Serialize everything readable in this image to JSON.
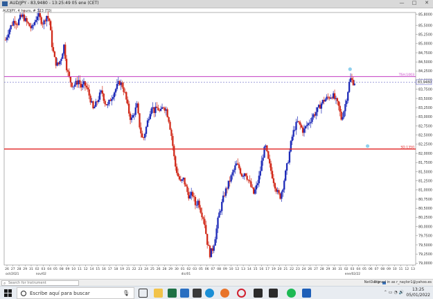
{
  "window": {
    "title": "AUD/JPY - 83,9480 - 13:25:49 05 ene (CET)",
    "controls": [
      "—",
      "□",
      "✕"
    ]
  },
  "chart_subtitle": "AUDJPY, 4 hours, # 323 (T0)",
  "colors": {
    "bull": "#1e2bb8",
    "bear": "#d12a1a",
    "upper_line": "#c13ac1",
    "lower_line": "#e02020",
    "current_line": "#6b6bc8",
    "marker": "#8fd0ee"
  },
  "annotations": {
    "upper_label": "TSH.1003",
    "lower_label": "SD.1350",
    "current_label": "83,9480"
  },
  "chart_data": {
    "type": "candlestick",
    "timeframe": "4 hours",
    "ylim": [
      78.95,
      85.85
    ],
    "y_ticks": [
      "85,8000",
      "85,5000",
      "85,2500",
      "85,0000",
      "84,7500",
      "84,5000",
      "84,2500",
      "84,0000",
      "83,7500",
      "83,5000",
      "83,2500",
      "83,0000",
      "82,7500",
      "82,5000",
      "82,2500",
      "82,0000",
      "81,7500",
      "81,5000",
      "81,2500",
      "81,0000",
      "80,7500",
      "80,5000",
      "80,2500",
      "80,0000",
      "79,7500",
      "79,5000",
      "79,2500",
      "79,0000"
    ],
    "x_ticks": [
      "26",
      "27",
      "28",
      "29",
      "31",
      "02",
      "03",
      "04",
      "05",
      "08",
      "09",
      "10",
      "11",
      "12",
      "14",
      "15",
      "16",
      "17",
      "18",
      "19",
      "21",
      "22",
      "23",
      "24",
      "25",
      "26",
      "28",
      "29",
      "30",
      "01",
      "02",
      "03",
      "05",
      "06",
      "07",
      "08",
      "09",
      "10",
      "12",
      "13",
      "14",
      "15",
      "16",
      "17",
      "19",
      "20",
      "21",
      "22",
      "23",
      "24",
      "26",
      "27",
      "28",
      "29",
      "30",
      "31",
      "02",
      "03",
      "04",
      "05",
      "06",
      "07",
      "08",
      "09",
      "10",
      "11",
      "12",
      "13"
    ],
    "month_labels": [
      {
        "label": "oct/2021",
        "at": 0
      },
      {
        "label": "nov/02",
        "at": 5
      },
      {
        "label": "dic/01",
        "at": 29
      },
      {
        "label": "ene/02/22",
        "at": 56
      }
    ],
    "levels": {
      "upper": 84.1,
      "lower": 82.12,
      "current": 83.948
    },
    "path": [
      [
        0,
        85.1
      ],
      [
        1,
        85.35
      ],
      [
        2,
        85.5
      ],
      [
        3,
        85.65
      ],
      [
        4,
        85.55
      ],
      [
        5,
        85.7
      ],
      [
        6,
        85.75
      ],
      [
        7,
        85.6
      ],
      [
        8,
        85.5
      ],
      [
        9,
        85.4
      ],
      [
        10,
        85.6
      ],
      [
        11,
        85.8
      ],
      [
        12,
        85.65
      ],
      [
        13,
        85.55
      ],
      [
        14,
        85.78
      ],
      [
        15,
        85.62
      ],
      [
        16,
        84.9
      ],
      [
        17,
        84.5
      ],
      [
        18,
        84.4
      ],
      [
        19,
        84.6
      ],
      [
        20,
        84.95
      ],
      [
        21,
        84.3
      ],
      [
        22,
        84.0
      ],
      [
        23,
        83.85
      ],
      [
        24,
        83.9
      ],
      [
        25,
        84.0
      ],
      [
        26,
        83.8
      ],
      [
        27,
        83.9
      ],
      [
        28,
        83.75
      ],
      [
        29,
        83.5
      ],
      [
        30,
        83.2
      ],
      [
        31,
        83.35
      ],
      [
        32,
        83.55
      ],
      [
        33,
        83.7
      ],
      [
        34,
        83.4
      ],
      [
        35,
        83.3
      ],
      [
        36,
        83.5
      ],
      [
        37,
        83.65
      ],
      [
        38,
        83.8
      ],
      [
        39,
        83.95
      ],
      [
        40,
        83.85
      ],
      [
        41,
        83.6
      ],
      [
        42,
        83.2
      ],
      [
        43,
        82.9
      ],
      [
        44,
        83.1
      ],
      [
        45,
        83.3
      ],
      [
        46,
        82.7
      ],
      [
        47,
        82.35
      ],
      [
        48,
        82.65
      ],
      [
        49,
        83.0
      ],
      [
        50,
        83.3
      ],
      [
        51,
        83.15
      ],
      [
        52,
        83.25
      ],
      [
        53,
        83.1
      ],
      [
        54,
        83.3
      ],
      [
        55,
        83.2
      ],
      [
        56,
        82.9
      ],
      [
        57,
        82.4
      ],
      [
        58,
        81.7
      ],
      [
        59,
        81.4
      ],
      [
        60,
        81.2
      ],
      [
        61,
        81.3
      ],
      [
        62,
        81.0
      ],
      [
        63,
        80.8
      ],
      [
        64,
        80.9
      ],
      [
        65,
        80.6
      ],
      [
        66,
        80.7
      ],
      [
        67,
        80.4
      ],
      [
        68,
        80.2
      ],
      [
        69,
        79.6
      ],
      [
        70,
        79.25
      ],
      [
        71,
        79.4
      ],
      [
        72,
        79.8
      ],
      [
        73,
        80.3
      ],
      [
        74,
        80.6
      ],
      [
        75,
        80.9
      ],
      [
        76,
        81.1
      ],
      [
        77,
        81.3
      ],
      [
        78,
        81.5
      ],
      [
        79,
        81.7
      ],
      [
        80,
        81.6
      ],
      [
        81,
        81.4
      ],
      [
        82,
        81.5
      ],
      [
        83,
        81.3
      ],
      [
        84,
        81.1
      ],
      [
        85,
        80.9
      ],
      [
        86,
        81.1
      ],
      [
        87,
        81.4
      ],
      [
        88,
        81.9
      ],
      [
        89,
        82.2
      ],
      [
        90,
        81.8
      ],
      [
        91,
        81.5
      ],
      [
        92,
        81.2
      ],
      [
        93,
        80.95
      ],
      [
        94,
        80.8
      ],
      [
        95,
        81.1
      ],
      [
        96,
        81.5
      ],
      [
        97,
        81.9
      ],
      [
        98,
        82.4
      ],
      [
        99,
        82.7
      ],
      [
        100,
        82.85
      ],
      [
        101,
        82.75
      ],
      [
        102,
        82.6
      ],
      [
        103,
        82.75
      ],
      [
        104,
        82.85
      ],
      [
        105,
        83.0
      ],
      [
        106,
        83.1
      ],
      [
        107,
        83.2
      ],
      [
        108,
        83.35
      ],
      [
        109,
        83.45
      ],
      [
        110,
        83.5
      ],
      [
        111,
        83.55
      ],
      [
        112,
        83.6
      ],
      [
        113,
        83.45
      ],
      [
        114,
        83.3
      ],
      [
        115,
        82.95
      ],
      [
        116,
        83.2
      ],
      [
        117,
        83.6
      ],
      [
        118,
        84.05
      ],
      [
        119,
        83.95
      ],
      [
        120,
        83.95
      ]
    ],
    "markers": [
      [
        118,
        84.3
      ],
      [
        124,
        82.2
      ]
    ]
  },
  "toolstrip": {
    "search_placeholder": "Search for Instrument",
    "brand": "NetDania",
    "signed": "Signed in as r_naylor1@yahoo.es"
  },
  "taskbar": {
    "search_text": "Escribe aquí para buscar",
    "time": "13:25",
    "date": "05/01/2022"
  }
}
